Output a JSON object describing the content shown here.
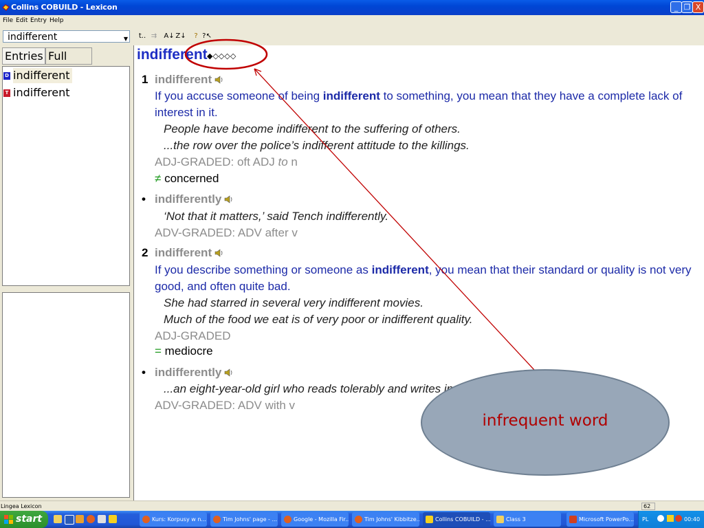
{
  "window": {
    "title": "Collins COBUILD - Lexicon",
    "buttons": {
      "minimize": "_",
      "restore": "❐",
      "close": "X"
    }
  },
  "menu": [
    "File",
    "Edit",
    "Entry",
    "Help"
  ],
  "search": {
    "value": "indifferent"
  },
  "toolbar": {
    "labels": [
      "t..",
      "⁠⇉",
      "A-Z↑",
      "Z-A↓",
      "?",
      "?↖"
    ]
  },
  "left_tabs": {
    "entries": "Entries",
    "fulltext": "Full text"
  },
  "entries": [
    {
      "badge": "D",
      "label": "indifferent",
      "color": "#1a22c8"
    },
    {
      "badge": "T",
      "label": "indifferent",
      "color": "#c81a2a"
    }
  ],
  "article": {
    "headword": "indifferent",
    "frequency": "◆◇◇◇◇",
    "sense1": {
      "num": "1",
      "word": "indifferent",
      "def_line1_pre": "If you accuse someone of being ",
      "def_line1_bold": "indifferent",
      "def_line1_post": " to something, you mean that they have a complete lack of",
      "def_line2": "interest  in it.",
      "ex1": "People have become indifferent to the suffering of others.",
      "ex2": "...the row over the police’s indifferent attitude to the killings.",
      "gram_pre": "ADJ-GRADED: oft ADJ ",
      "gram_ital": "to",
      "gram_post": " n",
      "rel_sym": "≠",
      "rel_word": "concerned"
    },
    "sub1": {
      "bullet": "•",
      "word": "indifferently",
      "ex": "‘Not that it matters,’ said Tench indifferently.",
      "gram": "ADV-GRADED: ADV after v"
    },
    "sense2": {
      "num": "2",
      "word": "indifferent",
      "def_line1_pre": "If you describe something or someone as ",
      "def_line1_bold": "indifferent",
      "def_line1_post": ", you mean that their standard or quality is not very",
      "def_line2": "good,  and often quite bad.",
      "ex1": "She had starred in several very indifferent movies.",
      "ex2": "Much of the food we eat is of very poor or indifferent quality.",
      "gram": "ADJ-GRADED",
      "rel_sym": "=",
      "rel_word": "mediocre"
    },
    "sub2": {
      "bullet": "•",
      "word": "indifferently",
      "ex": "...an eight-year-old girl who reads tolerably and writes in",
      "gram": "ADV-GRADED: ADV with v"
    }
  },
  "annotation": {
    "text": "infrequent word",
    "color": "#b00000"
  },
  "status": {
    "text": "Lingea Lexicon",
    "number": "62"
  },
  "taskbar": {
    "start": "start",
    "tasks": [
      {
        "label": "Kurs: Korpusy w n..."
      },
      {
        "label": "Tim Johns' page - ..."
      },
      {
        "label": "Google - Mozilla Fir..."
      },
      {
        "label": "Tim Johns' Kibbitze..."
      },
      {
        "label": "Collins COBUILD - ..."
      },
      {
        "label": "Class 3"
      },
      {
        "label": "Microsoft PowerPo..."
      }
    ],
    "lang": "PL",
    "clock": "00:40"
  }
}
